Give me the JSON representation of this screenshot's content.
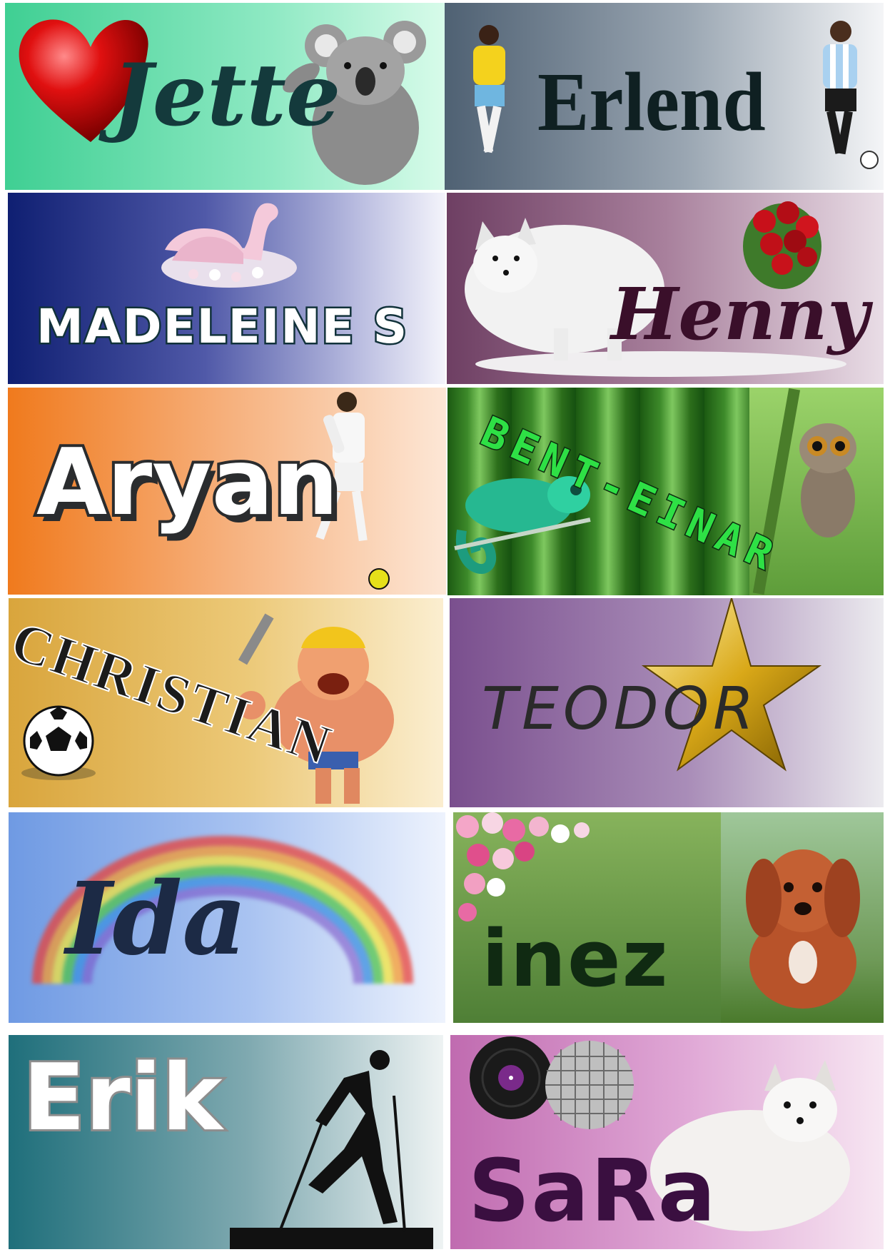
{
  "tags": [
    {
      "name": "Jette"
    },
    {
      "name": "Erlend"
    },
    {
      "name": "MADELEINE S"
    },
    {
      "name": "Henny"
    },
    {
      "name": "Aryan"
    },
    {
      "name": "Bent-einar"
    },
    {
      "name": "CHRISTIAN"
    },
    {
      "name": "TEODOR"
    },
    {
      "name": "Ida"
    },
    {
      "name": "inez"
    },
    {
      "name": "Erik"
    },
    {
      "name": "SaRa"
    }
  ],
  "icons": [
    "heart-icon",
    "koala-image",
    "football-player-image",
    "swan-image",
    "arctic-fox-image",
    "roses-image",
    "soccer-player-image",
    "chameleon-image",
    "tarsier-image",
    "barbarian-character-image",
    "soccer-ball-icon",
    "star-icon",
    "rainbow-image",
    "flowers-image",
    "puppy-image",
    "skier-silhouette-image",
    "vinyl-record-image",
    "disco-ball-image"
  ]
}
